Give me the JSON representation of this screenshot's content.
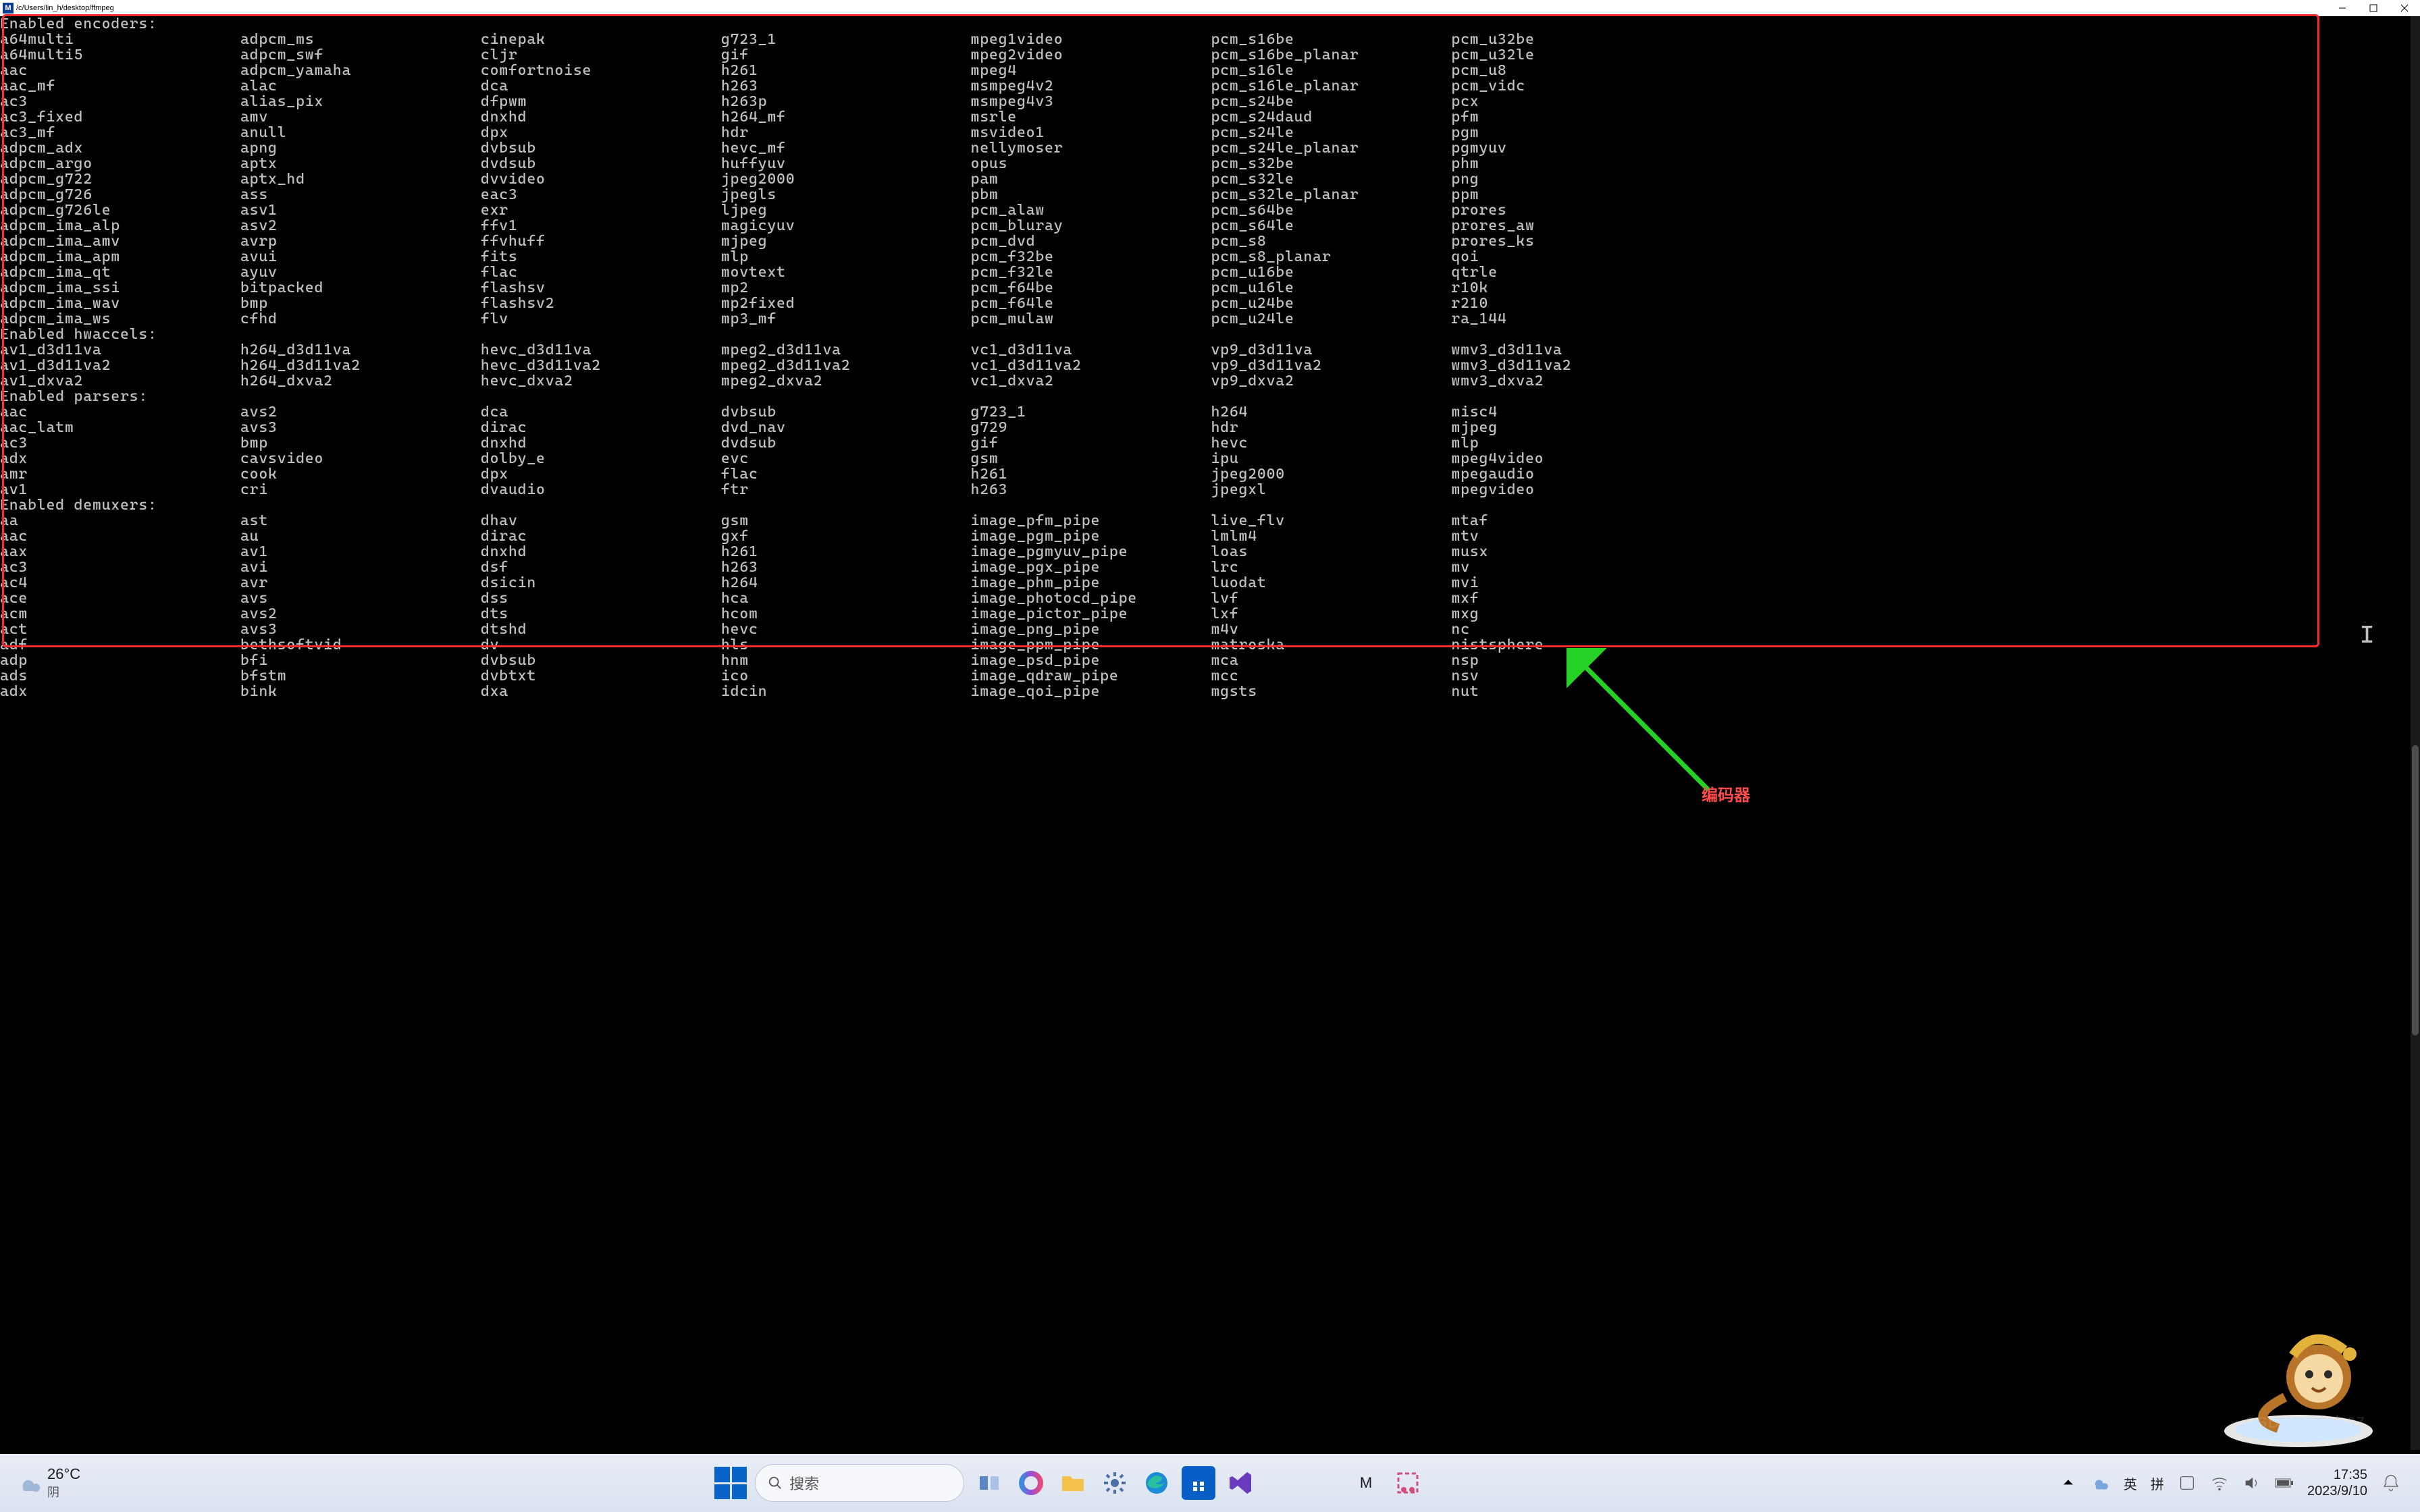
{
  "window": {
    "title": "/c/Users/lin_h/desktop/ffmpeg"
  },
  "encoders": {
    "header": "Enabled encoders:",
    "cols": [
      [
        "a64multi",
        "a64multi5",
        "aac",
        "aac_mf",
        "ac3",
        "ac3_fixed",
        "ac3_mf",
        "adpcm_adx",
        "adpcm_argo",
        "adpcm_g722",
        "adpcm_g726",
        "adpcm_g726le",
        "adpcm_ima_alp",
        "adpcm_ima_amv",
        "adpcm_ima_apm",
        "adpcm_ima_qt",
        "adpcm_ima_ssi",
        "adpcm_ima_wav",
        "adpcm_ima_ws"
      ],
      [
        "adpcm_ms",
        "adpcm_swf",
        "adpcm_yamaha",
        "alac",
        "alias_pix",
        "amv",
        "anull",
        "apng",
        "aptx",
        "aptx_hd",
        "ass",
        "asv1",
        "asv2",
        "avrp",
        "avui",
        "ayuv",
        "bitpacked",
        "bmp",
        "cfhd"
      ],
      [
        "cinepak",
        "cljr",
        "comfortnoise",
        "dca",
        "dfpwm",
        "dnxhd",
        "dpx",
        "dvbsub",
        "dvdsub",
        "dvvideo",
        "eac3",
        "exr",
        "ffv1",
        "ffvhuff",
        "fits",
        "flac",
        "flashsv",
        "flashsv2",
        "flv"
      ],
      [
        "g723_1",
        "gif",
        "h261",
        "h263",
        "h263p",
        "h264_mf",
        "hdr",
        "hevc_mf",
        "huffyuv",
        "jpeg2000",
        "jpegls",
        "ljpeg",
        "magicyuv",
        "mjpeg",
        "mlp",
        "movtext",
        "mp2",
        "mp2fixed",
        "mp3_mf"
      ],
      [
        "mpeg1video",
        "mpeg2video",
        "mpeg4",
        "msmpeg4v2",
        "msmpeg4v3",
        "msrle",
        "msvideo1",
        "nellymoser",
        "opus",
        "pam",
        "pbm",
        "pcm_alaw",
        "pcm_bluray",
        "pcm_dvd",
        "pcm_f32be",
        "pcm_f32le",
        "pcm_f64be",
        "pcm_f64le",
        "pcm_mulaw"
      ],
      [
        "pcm_s16be",
        "pcm_s16be_planar",
        "pcm_s16le",
        "pcm_s16le_planar",
        "pcm_s24be",
        "pcm_s24daud",
        "pcm_s24le",
        "pcm_s24le_planar",
        "pcm_s32be",
        "pcm_s32le",
        "pcm_s32le_planar",
        "pcm_s64be",
        "pcm_s64le",
        "pcm_s8",
        "pcm_s8_planar",
        "pcm_u16be",
        "pcm_u16le",
        "pcm_u24be",
        "pcm_u24le"
      ],
      [
        "pcm_u32be",
        "pcm_u32le",
        "pcm_u8",
        "pcm_vidc",
        "pcx",
        "pfm",
        "pgm",
        "pgmyuv",
        "phm",
        "png",
        "ppm",
        "prores",
        "prores_aw",
        "prores_ks",
        "qoi",
        "qtrle",
        "r10k",
        "r210",
        "ra_144"
      ]
    ]
  },
  "hwaccels": {
    "header": "Enabled hwaccels:",
    "cols": [
      [
        "av1_d3d11va",
        "av1_d3d11va2",
        "av1_dxva2"
      ],
      [
        "h264_d3d11va",
        "h264_d3d11va2",
        "h264_dxva2"
      ],
      [
        "hevc_d3d11va",
        "hevc_d3d11va2",
        "hevc_dxva2"
      ],
      [
        "mpeg2_d3d11va",
        "mpeg2_d3d11va2",
        "mpeg2_dxva2"
      ],
      [
        "vc1_d3d11va",
        "vc1_d3d11va2",
        "vc1_dxva2"
      ],
      [
        "vp9_d3d11va",
        "vp9_d3d11va2",
        "vp9_dxva2"
      ],
      [
        "wmv3_d3d11va",
        "wmv3_d3d11va2",
        "wmv3_dxva2"
      ]
    ]
  },
  "parsers": {
    "header": "Enabled parsers:",
    "cols": [
      [
        "aac",
        "aac_latm",
        "ac3",
        "adx",
        "amr",
        "av1"
      ],
      [
        "avs2",
        "avs3",
        "bmp",
        "cavsvideo",
        "cook",
        "cri"
      ],
      [
        "dca",
        "dirac",
        "dnxhd",
        "dolby_e",
        "dpx",
        "dvaudio"
      ],
      [
        "dvbsub",
        "dvd_nav",
        "dvdsub",
        "evc",
        "flac",
        "ftr"
      ],
      [
        "g723_1",
        "g729",
        "gif",
        "gsm",
        "h261",
        "h263"
      ],
      [
        "h264",
        "hdr",
        "hevc",
        "ipu",
        "jpeg2000",
        "jpegxl"
      ],
      [
        "misc4",
        "mjpeg",
        "mlp",
        "mpeg4video",
        "mpegaudio",
        "mpegvideo"
      ]
    ]
  },
  "demuxers": {
    "header": "Enabled demuxers:",
    "cols": [
      [
        "aa",
        "aac",
        "aax",
        "ac3",
        "ac4",
        "ace",
        "acm",
        "act",
        "adf",
        "adp",
        "ads",
        "adx"
      ],
      [
        "ast",
        "au",
        "av1",
        "avi",
        "avr",
        "avs",
        "avs2",
        "avs3",
        "bethsoftvid",
        "bfi",
        "bfstm",
        "bink"
      ],
      [
        "dhav",
        "dirac",
        "dnxhd",
        "dsf",
        "dsicin",
        "dss",
        "dts",
        "dtshd",
        "dv",
        "dvbsub",
        "dvbtxt",
        "dxa"
      ],
      [
        "gsm",
        "gxf",
        "h261",
        "h263",
        "h264",
        "hca",
        "hcom",
        "hevc",
        "hls",
        "hnm",
        "ico",
        "idcin"
      ],
      [
        "image_pfm_pipe",
        "image_pgm_pipe",
        "image_pgmyuv_pipe",
        "image_pgx_pipe",
        "image_phm_pipe",
        "image_photocd_pipe",
        "image_pictor_pipe",
        "image_png_pipe",
        "image_ppm_pipe",
        "image_psd_pipe",
        "image_qdraw_pipe",
        "image_qoi_pipe"
      ],
      [
        "live_flv",
        "lmlm4",
        "loas",
        "lrc",
        "luodat",
        "lvf",
        "lxf",
        "m4v",
        "matroska",
        "mca",
        "mcc",
        "mgsts"
      ],
      [
        "mtaf",
        "mtv",
        "musx",
        "mv",
        "mvi",
        "mxf",
        "mxg",
        "nc",
        "nistsphere",
        "nsp",
        "nsv",
        "nut"
      ]
    ]
  },
  "annotation": "编码器",
  "search_placeholder": "搜索",
  "weather": {
    "temp": "26°C",
    "cond": "阴"
  },
  "ime": {
    "lang1": "英",
    "lang2": "拼"
  },
  "clock": {
    "time": "17:35",
    "date": "2023/9/10"
  },
  "col_offsets": [
    0,
    26,
    52,
    78,
    105,
    131,
    157
  ]
}
